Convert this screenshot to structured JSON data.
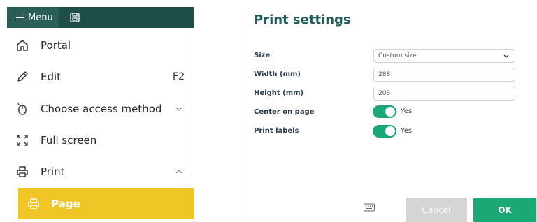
{
  "menu": {
    "menu_label": "Menu",
    "items": [
      {
        "icon": "home-icon",
        "label": "Portal"
      },
      {
        "icon": "pencil-icon",
        "label": "Edit",
        "shortcut": "F2"
      },
      {
        "icon": "mouse-icon",
        "label": "Choose access method"
      },
      {
        "icon": "fullscreen-icon",
        "label": "Full screen"
      },
      {
        "icon": "printer-icon",
        "label": "Print"
      }
    ],
    "subitem": {
      "icon": "printer-icon",
      "label": "Page"
    }
  },
  "settings": {
    "title": "Print settings",
    "size": {
      "label": "Size",
      "value": "Custom size"
    },
    "width": {
      "label": "Width (mm)",
      "value": "288"
    },
    "height": {
      "label": "Height (mm)",
      "value": "203"
    },
    "center_on_page": {
      "label": "Center on page",
      "state": "Yes"
    },
    "print_labels": {
      "label": "Print labels",
      "state": "Yes"
    },
    "cancel_label": "Cancel",
    "ok_label": "OK"
  },
  "colors": {
    "topbar": "#1f4d47",
    "accent_green": "#1aa875",
    "highlight_yellow": "#f0c526",
    "title_teal": "#1f5c58"
  }
}
